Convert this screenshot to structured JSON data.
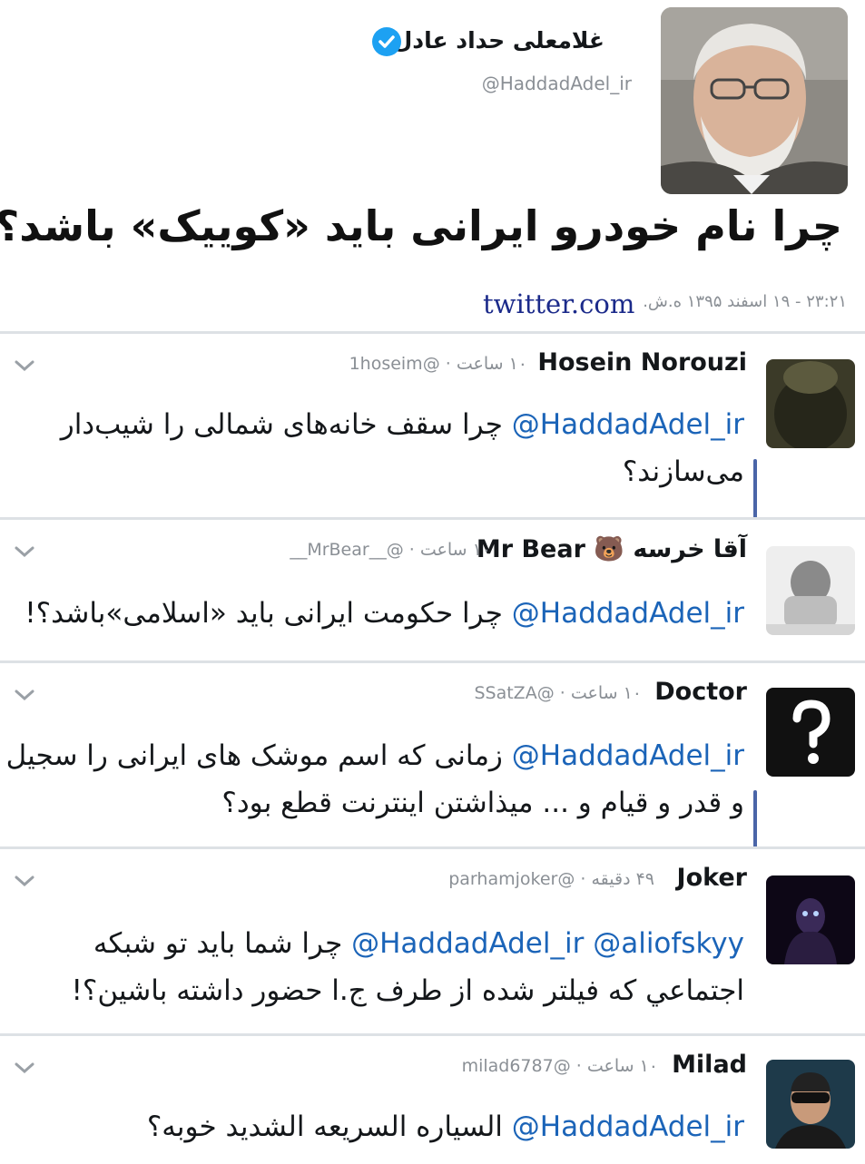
{
  "main_tweet": {
    "name": "غلامعلی حداد عادل",
    "handle": "@HaddadAdel_ir",
    "text": "چرا نام خودرو ایرانی باید «کوییک» باشد؟!",
    "timestamp": "۲۳:۲۱ - ۱۹ اسفند ۱۳۹۵ ه.ش.",
    "source": "twitter.com",
    "verified_icon": "verified-badge-icon"
  },
  "replies": [
    {
      "name": "Hosein Norouzi",
      "handle": "@1hoseim",
      "time": "۱۰ ساعت",
      "mention": "@HaddadAdel_ir",
      "line1": "چرا سقف خانه‌های شمالی را شیب‌دار",
      "line2": "می‌سازند؟"
    },
    {
      "name": "Mr Bear",
      "name_fa": "آقا خرسه",
      "emoji": "🐻",
      "handle": "@__MrBear__",
      "time": "۱۰ ساعت",
      "mention": "@HaddadAdel_ir",
      "line1": "چرا حکومت ایرانی باید «اسلامی»باشد؟!"
    },
    {
      "name": "Doctor",
      "handle": "@SSatZA",
      "time": "۱۰ ساعت",
      "mention": "@HaddadAdel_ir",
      "line1": "زمانی که اسم موشک های ایرانی را سجیل",
      "line2": "و قدر و قیام و ... میذاشتن اینترنت قطع بود؟"
    },
    {
      "name": "Joker",
      "handle": "@parhamjoker",
      "time": "۴۹ دقیقه",
      "mention": "@HaddadAdel_ir",
      "mention2": "@aliofskyy",
      "line1": "چرا شما باید تو شبکه",
      "line2": "اجتماعي که فيلتر شده از طرف  ج.ا حضور داشته باشين؟!"
    },
    {
      "name": "Milad",
      "handle": "@milad6787",
      "time": "۱۰ ساعت",
      "mention": "@HaddadAdel_ir",
      "line1": "السياره السريعه الشديد  خوبه؟"
    }
  ],
  "colors": {
    "accent": "#1da1f2",
    "mention": "#1b64b8",
    "thread": "#4a65a8",
    "link": "#1b2a8a"
  }
}
